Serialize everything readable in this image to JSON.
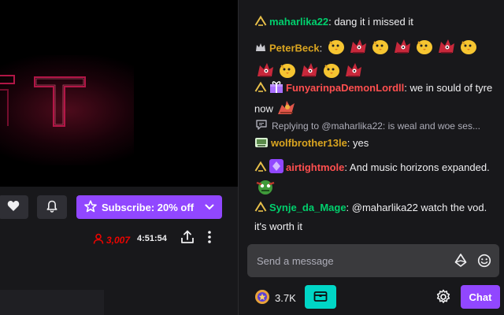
{
  "channel_actions": {
    "subscribe_label": "Subscribe: 20% off",
    "viewer_count": "3,007",
    "uptime": "4:51:54"
  },
  "chat": {
    "messages": [
      {
        "user": "maharlika22",
        "user_color": "#00d06d",
        "text": "dang it i missed it"
      },
      {
        "user": "PeterBeck",
        "user_color": "#daa520",
        "text": ""
      },
      {
        "user": "FunyarinpaDemonLordll",
        "user_color": "#ff4f4f",
        "text": "we in sould of tyre now"
      },
      {
        "reply_context": "Replying to @maharlika22: is weal and woe ses...",
        "user": "wolfbrother13le",
        "user_color": "#daa520",
        "text": "yes"
      },
      {
        "user": "airtightmole",
        "user_color": "#ff4f4f",
        "text": "And music horizons expanded."
      },
      {
        "user": "Synje_da_Mage",
        "user_color": "#00d06d",
        "text": "@maharlika22 watch the vod. it's worth it"
      }
    ],
    "separator": ": ",
    "input_placeholder": "Send a message",
    "points_balance": "3.7K",
    "chat_button_label": "Chat"
  },
  "colors": {
    "accent": "#9147ff",
    "teal": "#00d6c6",
    "live_red": "#eb0400"
  },
  "icons": [
    "heart-icon",
    "bell-icon",
    "star-icon",
    "chevron-down-icon",
    "person-icon",
    "share-icon",
    "more-vertical-icon",
    "bits-icon",
    "emote-smile-icon",
    "channel-points-icon",
    "chest-icon",
    "gear-icon",
    "reply-icon",
    "prime-crown-badge",
    "gift-badge",
    "diamond-badge",
    "hype-chat-badge"
  ]
}
